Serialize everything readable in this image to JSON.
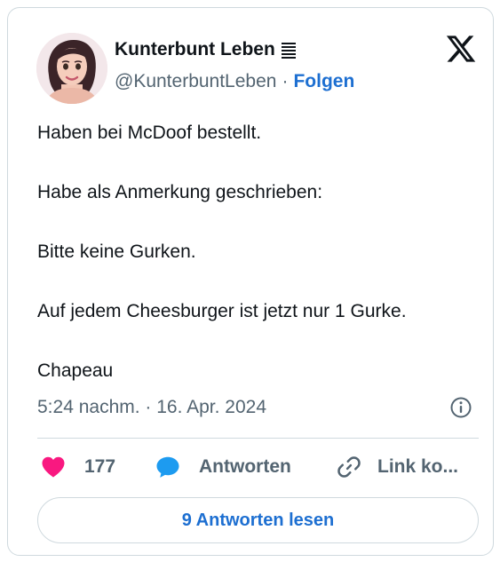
{
  "author": {
    "name": "Kunterbunt Leben",
    "handle": "@KunterbuntLeben",
    "separator": "·",
    "follow_label": "Folgen"
  },
  "tweet": {
    "lines": [
      "Haben bei McDoof bestellt.",
      "Habe als Anmerkung geschrieben:",
      "Bitte keine Gurken.",
      "Auf jedem Cheesburger ist jetzt nur 1 Gurke.",
      "Chapeau"
    ],
    "timestamp": "5:24 nachm. · 16. Apr. 2024"
  },
  "actions": {
    "like_count": "177",
    "reply_label": "Antworten",
    "link_label": "Link ko..."
  },
  "read_replies_label": "9 Antworten lesen",
  "icons": {
    "like": "heart-icon",
    "reply": "speech-bubble-icon",
    "link": "link-icon",
    "info": "info-icon",
    "logo": "x-logo-icon",
    "badge": "book-emoji-icon"
  },
  "colors": {
    "like": "#f91880",
    "reply": "#1d9bf0",
    "accent_link": "#1d6fd1",
    "secondary_text": "#536471",
    "border": "#cfd9de"
  }
}
